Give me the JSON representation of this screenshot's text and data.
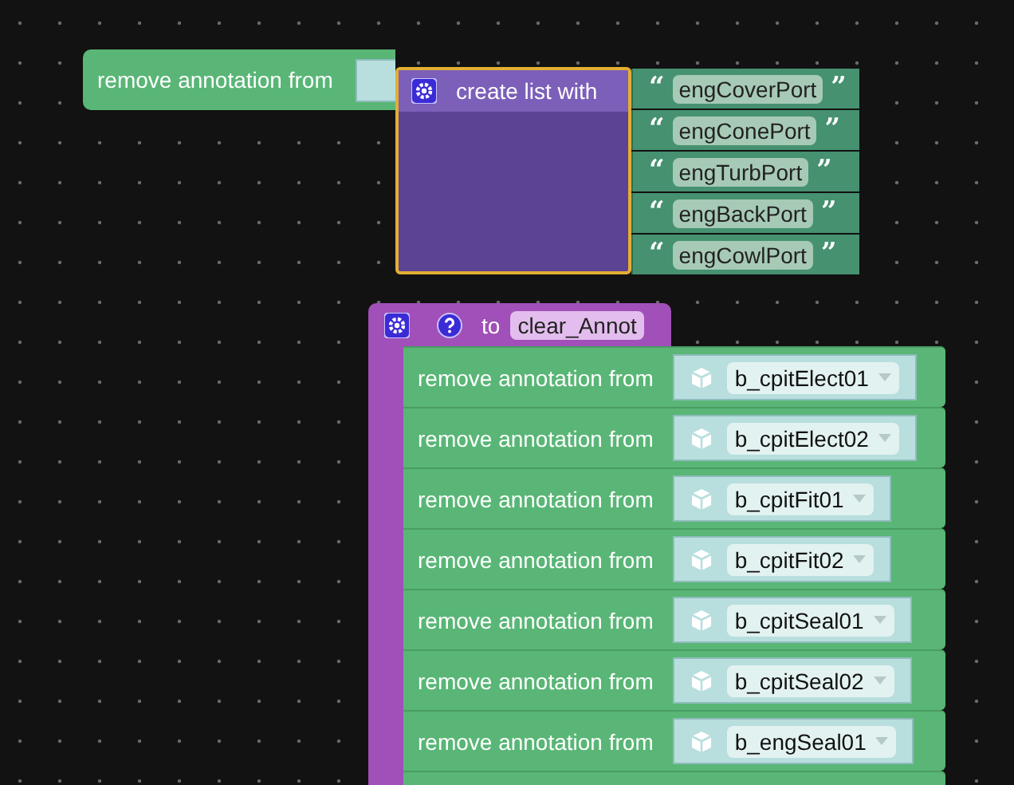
{
  "remove_block": {
    "label": "remove annotation from"
  },
  "create_list_block": {
    "label": "create list with",
    "open_quote": "“",
    "close_quote": "”",
    "items": [
      "engCoverPort",
      "engConePort",
      "engTurbPort",
      "engBackPort",
      "engCowlPort"
    ]
  },
  "procedure": {
    "keyword": "to",
    "name": "clear_Annot",
    "statements": [
      {
        "label": "remove annotation from",
        "object": "b_cpitElect01"
      },
      {
        "label": "remove annotation from",
        "object": "b_cpitElect02"
      },
      {
        "label": "remove annotation from",
        "object": "b_cpitFit01"
      },
      {
        "label": "remove annotation from",
        "object": "b_cpitFit02"
      },
      {
        "label": "remove annotation from",
        "object": "b_cpitSeal01"
      },
      {
        "label": "remove annotation from",
        "object": "b_cpitSeal02"
      },
      {
        "label": "remove annotation from",
        "object": "b_engSeal01"
      }
    ]
  }
}
